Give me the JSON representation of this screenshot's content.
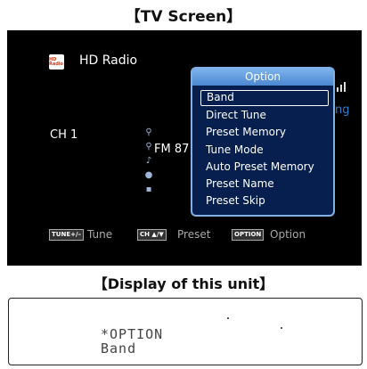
{
  "captions": {
    "tv": "【TV Screen】",
    "display": "【Display of this unit】"
  },
  "screen": {
    "source_title": "HD Radio",
    "logo_text": "HD Radio",
    "partial_text": "ng",
    "channel": "CH 1",
    "frequency_partial": "FM 87",
    "option_menu": {
      "title": "Option",
      "items": [
        "Band",
        "Direct Tune",
        "Preset Memory",
        "Tune Mode",
        "Auto Preset Memory",
        "Preset Name",
        "Preset Skip"
      ],
      "selected_index": 0
    },
    "bottom_bar": {
      "tune_key": "TUNE+/–",
      "tune_label": "Tune",
      "preset_key": "CH ▲/▼",
      "preset_label": "Preset",
      "option_key": "OPTION",
      "option_label": "Option"
    }
  },
  "unit_display": {
    "line1": "*OPTION",
    "line2": "Band"
  }
}
